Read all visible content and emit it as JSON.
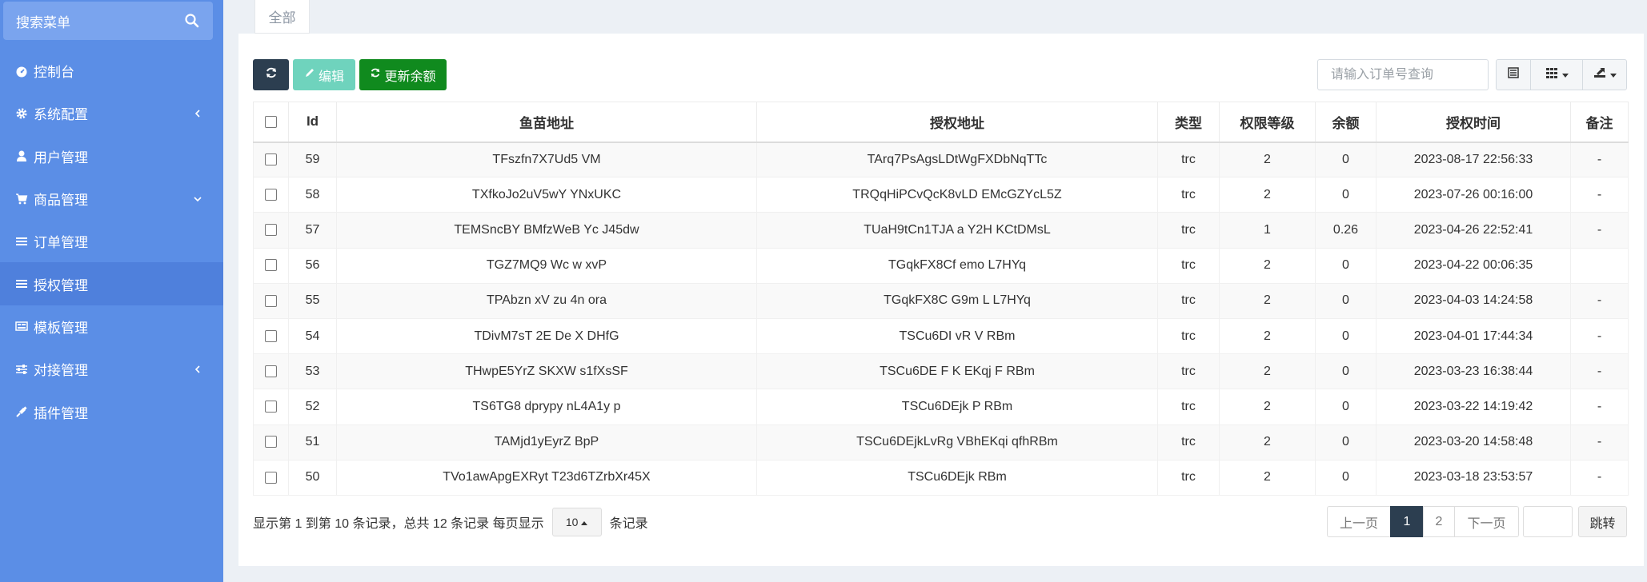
{
  "sidebar": {
    "search_placeholder": "搜索菜单",
    "items": [
      {
        "label": "控制台",
        "icon": "dashboard-icon",
        "arrow": ""
      },
      {
        "label": "系统配置",
        "icon": "gear-icon",
        "arrow": "chevron-left"
      },
      {
        "label": "用户管理",
        "icon": "user-icon",
        "arrow": ""
      },
      {
        "label": "商品管理",
        "icon": "cart-icon",
        "arrow": "chevron-down"
      },
      {
        "label": "订单管理",
        "icon": "list-icon",
        "arrow": ""
      },
      {
        "label": "授权管理",
        "icon": "list-icon",
        "arrow": "",
        "active": true
      },
      {
        "label": "模板管理",
        "icon": "template-icon",
        "arrow": ""
      },
      {
        "label": "对接管理",
        "icon": "sliders-icon",
        "arrow": "chevron-left"
      },
      {
        "label": "插件管理",
        "icon": "plug-icon",
        "arrow": ""
      }
    ]
  },
  "tabs": {
    "all_label": "全部"
  },
  "toolbar": {
    "edit_label": "编辑",
    "update_balance_label": "更新余额",
    "order_search_placeholder": "请输入订单号查询"
  },
  "table": {
    "headers": [
      "Id",
      "鱼苗地址",
      "授权地址",
      "类型",
      "权限等级",
      "余额",
      "授权时间",
      "备注"
    ],
    "rows": [
      {
        "id": "59",
        "fish": "TFszfn7X7Ud5 VM",
        "auth": "TArq7PsAgsLDtWgFXDbNqTTc",
        "type": "trc",
        "level": "2",
        "balance": "0",
        "time": "2023-08-17 22:56:33",
        "note": "-"
      },
      {
        "id": "58",
        "fish": "TXfkoJo2uV5wY YNxUKC",
        "auth": "TRQqHiPCvQcK8vLD EMcGZYcL5Z",
        "type": "trc",
        "level": "2",
        "balance": "0",
        "time": "2023-07-26 00:16:00",
        "note": "-"
      },
      {
        "id": "57",
        "fish": "TEMSncBY BMfzWeB Yc J45dw",
        "auth": "TUaH9tCn1TJA a Y2H KCtDMsL",
        "type": "trc",
        "level": "1",
        "balance": "0.26",
        "time": "2023-04-26 22:52:41",
        "note": "-"
      },
      {
        "id": "56",
        "fish": "TGZ7MQ9 Wc w xvP",
        "auth": "TGqkFX8Cf emo L7HYq",
        "type": "trc",
        "level": "2",
        "balance": "0",
        "time": "2023-04-22 00:06:35",
        "note": ""
      },
      {
        "id": "55",
        "fish": "TPAbzn xV zu 4n ora",
        "auth": "TGqkFX8C G9m L L7HYq",
        "type": "trc",
        "level": "2",
        "balance": "0",
        "time": "2023-04-03 14:24:58",
        "note": "-"
      },
      {
        "id": "54",
        "fish": "TDivM7sT 2E De X DHfG",
        "auth": "TSCu6DI vR V RBm",
        "type": "trc",
        "level": "2",
        "balance": "0",
        "time": "2023-04-01 17:44:34",
        "note": "-"
      },
      {
        "id": "53",
        "fish": "THwpE5YrZ SKXW s1fXsSF",
        "auth": "TSCu6DE F K EKqj F RBm",
        "type": "trc",
        "level": "2",
        "balance": "0",
        "time": "2023-03-23 16:38:44",
        "note": "-"
      },
      {
        "id": "52",
        "fish": "TS6TG8 dprypy nL4A1y p",
        "auth": "TSCu6DEjk P RBm",
        "type": "trc",
        "level": "2",
        "balance": "0",
        "time": "2023-03-22 14:19:42",
        "note": "-"
      },
      {
        "id": "51",
        "fish": "TAMjd1yEyrZ BpP",
        "auth": "TSCu6DEjkLvRg VBhEKqi qfhRBm",
        "type": "trc",
        "level": "2",
        "balance": "0",
        "time": "2023-03-20 14:58:48",
        "note": "-"
      },
      {
        "id": "50",
        "fish": "TVo1awApgEXRyt T23d6TZrbXr45X",
        "auth": "TSCu6DEjk RBm",
        "type": "trc",
        "level": "2",
        "balance": "0",
        "time": "2023-03-18 23:53:57",
        "note": "-"
      }
    ]
  },
  "footer": {
    "info_text": "显示第 1 到第 10 条记录，总共 12 条记录 每页显示",
    "page_size": "10",
    "records_suffix": "条记录",
    "prev_label": "上一页",
    "page1": "1",
    "page2": "2",
    "next_label": "下一页",
    "jump_label": "跳转"
  },
  "colors": {
    "sidebar_bg": "#5b8ee6",
    "sidebar_active": "#4f80dc",
    "btn_dark": "#2c3e50",
    "btn_edit": "#6fd3bd",
    "btn_update": "#108a1e"
  }
}
